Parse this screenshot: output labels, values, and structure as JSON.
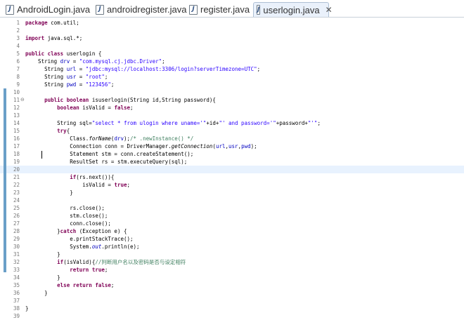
{
  "tabs": [
    {
      "label": "AndroidLogin.java",
      "icon": "java-file-icon",
      "active": false
    },
    {
      "label": "androidregister.java",
      "icon": "java-file-icon",
      "active": false
    },
    {
      "label": "register.java",
      "icon": "java-file-icon",
      "active": false
    },
    {
      "label": "userlogin.java",
      "icon": "java-file-icon",
      "active": true,
      "close": "✕"
    }
  ],
  "editor": {
    "current_line": 20,
    "lines": [
      {
        "n": "1",
        "segs": [
          [
            "kw",
            "package"
          ],
          [
            "n",
            " com.util;"
          ]
        ]
      },
      {
        "n": "2",
        "segs": []
      },
      {
        "n": "3",
        "segs": [
          [
            "kw",
            "import"
          ],
          [
            "n",
            " java.sql.*;"
          ]
        ]
      },
      {
        "n": "4",
        "segs": []
      },
      {
        "n": "5",
        "segs": [
          [
            "kw",
            "public"
          ],
          [
            "n",
            " "
          ],
          [
            "kw",
            "class"
          ],
          [
            "n",
            " userlogin {"
          ]
        ]
      },
      {
        "n": "6",
        "segs": [
          [
            "n",
            "    String "
          ],
          [
            "fld",
            "drv"
          ],
          [
            "n",
            " = "
          ],
          [
            "str",
            "\"com.mysql.cj.jdbc.Driver\""
          ],
          [
            "n",
            ";"
          ]
        ]
      },
      {
        "n": "7",
        "segs": [
          [
            "n",
            "      String "
          ],
          [
            "fld",
            "url"
          ],
          [
            "n",
            " = "
          ],
          [
            "str",
            "\"jdbc:mysql://localhost:3306/login?serverTimezone=UTC\""
          ],
          [
            "n",
            ";"
          ]
        ]
      },
      {
        "n": "8",
        "segs": [
          [
            "n",
            "      String "
          ],
          [
            "fld",
            "usr"
          ],
          [
            "n",
            " = "
          ],
          [
            "str",
            "\"root\""
          ],
          [
            "n",
            ";"
          ]
        ]
      },
      {
        "n": "9",
        "segs": [
          [
            "n",
            "      String "
          ],
          [
            "fld",
            "pwd"
          ],
          [
            "n",
            " = "
          ],
          [
            "str",
            "\"123456\""
          ],
          [
            "n",
            ";"
          ]
        ]
      },
      {
        "n": "10",
        "segs": []
      },
      {
        "n": "11",
        "fold": "⊖",
        "segs": [
          [
            "n",
            "      "
          ],
          [
            "kw",
            "public"
          ],
          [
            "n",
            " "
          ],
          [
            "kw",
            "boolean"
          ],
          [
            "n",
            " isuserlogin(String id,String password){"
          ]
        ]
      },
      {
        "n": "12",
        "segs": [
          [
            "n",
            "          "
          ],
          [
            "kw",
            "boolean"
          ],
          [
            "n",
            " isValid = "
          ],
          [
            "kw",
            "false"
          ],
          [
            "n",
            ";"
          ]
        ]
      },
      {
        "n": "13",
        "segs": []
      },
      {
        "n": "14",
        "segs": [
          [
            "n",
            "          String sql="
          ],
          [
            "str",
            "\"select * from ulogin where uname='\""
          ],
          [
            "n",
            "+id+"
          ],
          [
            "str",
            "\"' and password='\""
          ],
          [
            "n",
            "+password+"
          ],
          [
            "str",
            "\"'\""
          ],
          [
            "n",
            ";"
          ]
        ]
      },
      {
        "n": "15",
        "segs": [
          [
            "n",
            "          "
          ],
          [
            "kw",
            "try"
          ],
          [
            "n",
            "{"
          ]
        ]
      },
      {
        "n": "16",
        "segs": [
          [
            "n",
            "              Class."
          ],
          [
            "it",
            "forName"
          ],
          [
            "n",
            "("
          ],
          [
            "fld",
            "drv"
          ],
          [
            "n",
            ");"
          ],
          [
            "cm",
            "/* .newInstance() */"
          ]
        ]
      },
      {
        "n": "17",
        "segs": [
          [
            "n",
            "              Connection conn = DriverManager."
          ],
          [
            "it",
            "getConnection"
          ],
          [
            "n",
            "("
          ],
          [
            "fld",
            "url"
          ],
          [
            "n",
            ","
          ],
          [
            "fld",
            "usr"
          ],
          [
            "n",
            ","
          ],
          [
            "fld",
            "pwd"
          ],
          [
            "n",
            ");"
          ]
        ]
      },
      {
        "n": "18",
        "segs": [
          [
            "n",
            "              Statement stm = conn.createStatement();"
          ]
        ]
      },
      {
        "n": "19",
        "segs": [
          [
            "n",
            "              ResultSet rs = stm.executeQuery(sql);"
          ]
        ]
      },
      {
        "n": "20",
        "segs": []
      },
      {
        "n": "21",
        "segs": [
          [
            "n",
            "              "
          ],
          [
            "kw",
            "if"
          ],
          [
            "n",
            "(rs.next()){"
          ]
        ]
      },
      {
        "n": "22",
        "segs": [
          [
            "n",
            "                  isValid = "
          ],
          [
            "kw",
            "true"
          ],
          [
            "n",
            ";"
          ]
        ]
      },
      {
        "n": "23",
        "segs": [
          [
            "n",
            "              }"
          ]
        ]
      },
      {
        "n": "24",
        "segs": []
      },
      {
        "n": "25",
        "segs": [
          [
            "n",
            "              rs.close();"
          ]
        ]
      },
      {
        "n": "26",
        "segs": [
          [
            "n",
            "              stm.close();"
          ]
        ]
      },
      {
        "n": "27",
        "segs": [
          [
            "n",
            "              conn.close();"
          ]
        ]
      },
      {
        "n": "28",
        "segs": [
          [
            "n",
            "          }"
          ],
          [
            "kw",
            "catch"
          ],
          [
            "n",
            " (Exception e) {"
          ]
        ]
      },
      {
        "n": "29",
        "segs": [
          [
            "n",
            "              e.printStackTrace();"
          ]
        ]
      },
      {
        "n": "30",
        "segs": [
          [
            "n",
            "              System."
          ],
          [
            "fldit",
            "out"
          ],
          [
            "n",
            ".println(e);"
          ]
        ]
      },
      {
        "n": "31",
        "segs": [
          [
            "n",
            "          }"
          ]
        ]
      },
      {
        "n": "32",
        "segs": [
          [
            "n",
            "          "
          ],
          [
            "kw",
            "if"
          ],
          [
            "n",
            "(isValid){"
          ],
          [
            "cm",
            "//判断用户名以及密码是否与设定相符"
          ]
        ]
      },
      {
        "n": "33",
        "segs": [
          [
            "n",
            "              "
          ],
          [
            "kw",
            "return"
          ],
          [
            "n",
            " "
          ],
          [
            "kw",
            "true"
          ],
          [
            "n",
            ";"
          ]
        ]
      },
      {
        "n": "34",
        "segs": [
          [
            "n",
            "          }"
          ]
        ]
      },
      {
        "n": "35",
        "segs": [
          [
            "n",
            "          "
          ],
          [
            "kw",
            "else"
          ],
          [
            "n",
            " "
          ],
          [
            "kw",
            "return"
          ],
          [
            "n",
            " "
          ],
          [
            "kw",
            "false"
          ],
          [
            "n",
            ";"
          ]
        ]
      },
      {
        "n": "36",
        "segs": [
          [
            "n",
            "      }"
          ]
        ]
      },
      {
        "n": "37",
        "segs": []
      },
      {
        "n": "38",
        "segs": [
          [
            "n",
            "}"
          ]
        ]
      },
      {
        "n": "39",
        "segs": []
      }
    ]
  },
  "colors": {
    "keyword": "#7f0055",
    "string": "#2a00ff",
    "comment": "#3f7f5f",
    "field": "#0000c0",
    "current_line": "#e8f2fe",
    "change_gutter": "#6a9fc8"
  }
}
